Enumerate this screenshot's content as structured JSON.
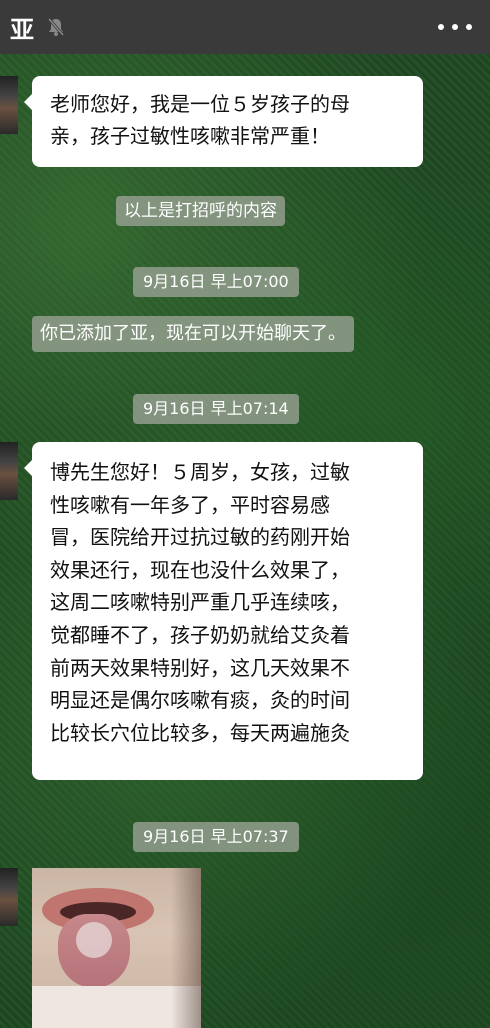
{
  "header": {
    "title": "亚",
    "mute_icon": "bell-muted-icon",
    "more_icon": "more-dots-icon"
  },
  "messages": {
    "msg1": {
      "lines": [
        "老师您好，我是一位５岁孩子的母",
        "亲，孩子过敏性咳嗽非常严重！"
      ]
    },
    "system1": "以上是打招呼的内容",
    "time1": "9月16日 早上07:00",
    "system2": "你已添加了亚，现在可以开始聊天了。",
    "time2": "9月16日 早上07:14",
    "msg2": {
      "lines": [
        "博先生您好！５周岁，女孩，过敏",
        "性咳嗽有一年多了，平时容易感",
        "冒，医院给开过抗过敏的药刚开始",
        "效果还行，现在也没什么效果了，",
        "这周二咳嗽特别严重几乎连续咳，",
        "觉都睡不了，孩子奶奶就给艾灸着",
        "前两天效果特别好，这几天效果不",
        "明显还是偶尔咳嗽有痰，灸的时间",
        "比较长穴位比较多，每天两遍施灸"
      ]
    },
    "time3": "9月16日 早上07:37"
  },
  "colors": {
    "header_bg": "#3a3a3a",
    "chat_bg": "#1f4a22",
    "bubble_bg": "#ffffff",
    "system_bg": "#96a091"
  }
}
